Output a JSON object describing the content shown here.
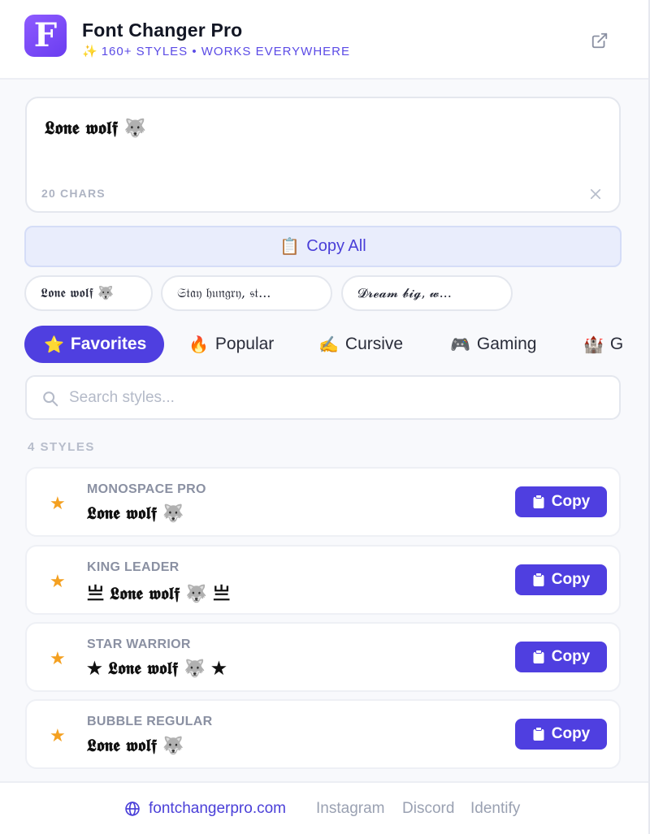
{
  "header": {
    "logo_letter": "F",
    "title": "Font Changer Pro",
    "subtitle_icon": "✨",
    "subtitle": "160+ STYLES • WORKS EVERYWHERE"
  },
  "input": {
    "value": "𝕷𝖔𝖓𝖊 𝖜𝖔𝖑𝖋 🐺",
    "char_count": "20 CHARS"
  },
  "copy_all": {
    "icon": "📋",
    "label": "Copy All"
  },
  "presets": [
    "𝕷𝖔𝖓𝖊 𝖜𝖔𝖑𝖋 🐺",
    "𝔖𝔱𝔞𝔶 𝔥𝔲𝔫𝔤𝔯𝔶, 𝔰𝔱...",
    "𝓓𝓻𝓮𝓪𝓶 𝓫𝓲𝓰, 𝔀..."
  ],
  "tabs": [
    {
      "emoji": "⭐",
      "label": "Favorites"
    },
    {
      "emoji": "🔥",
      "label": "Popular"
    },
    {
      "emoji": "✍️",
      "label": "Cursive"
    },
    {
      "emoji": "🎮",
      "label": "Gaming"
    },
    {
      "emoji": "🏰",
      "label": "G"
    }
  ],
  "search": {
    "placeholder": "Search styles..."
  },
  "count_label": "4 STYLES",
  "styles": [
    {
      "name": "MONOSPACE PRO",
      "preview": "𝕷𝖔𝖓𝖊 𝖜𝖔𝖑𝖋 🐺",
      "copy_label": "Copy"
    },
    {
      "name": "KING LEADER",
      "preview": "亗 𝕷𝖔𝖓𝖊 𝖜𝖔𝖑𝖋 🐺 亗",
      "copy_label": "Copy"
    },
    {
      "name": "STAR WARRIOR",
      "preview": "★ 𝕷𝖔𝖓𝖊 𝖜𝖔𝖑𝖋 🐺 ★",
      "copy_label": "Copy"
    },
    {
      "name": "BUBBLE REGULAR",
      "preview": "𝕷𝖔𝖓𝖊 𝖜𝖔𝖑𝖋 🐺",
      "copy_label": "Copy"
    }
  ],
  "footer": {
    "site": "fontchangerpro.com",
    "links": [
      "Instagram",
      "Discord",
      "Identify"
    ]
  },
  "colors": {
    "accent": "#4f3fe0",
    "star": "#f4a020",
    "logo_gradient_start": "#8e5bff",
    "logo_gradient_end": "#6a3df0"
  }
}
